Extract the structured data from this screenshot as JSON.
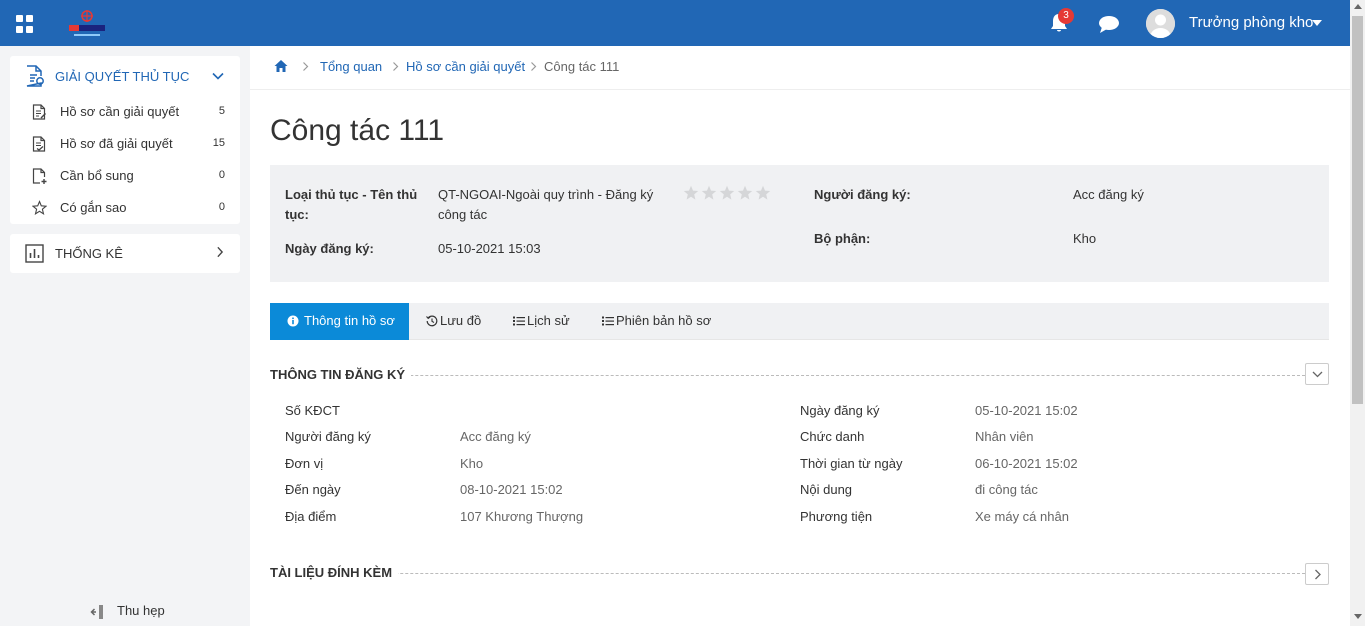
{
  "header": {
    "notification_count": "3",
    "username": "Trưởng phòng kho"
  },
  "sidebar": {
    "group_title": "GIẢI QUYẾT THỦ TỤC",
    "items": [
      {
        "label": "Hồ sơ cần giải quyết",
        "count": "5"
      },
      {
        "label": "Hồ sơ đã giải quyết",
        "count": "15"
      },
      {
        "label": "Cần bổ sung",
        "count": "0"
      },
      {
        "label": "Có gắn sao",
        "count": "0"
      }
    ],
    "stats_title": "THỐNG KÊ",
    "collapse_label": "Thu hẹp"
  },
  "breadcrumb": {
    "items": [
      "Tổng quan",
      "Hồ sơ cần giải quyết"
    ],
    "current": "Công tác 111"
  },
  "page": {
    "title": "Công tác 111"
  },
  "summary": {
    "type_label": "Loại thủ tục - Tên thủ tục:",
    "type_value": "QT-NGOAI-Ngoài quy trình - Đăng ký công tác",
    "date_label": "Ngày đăng ký:",
    "date_value": "05-10-2021 15:03",
    "registrant_label": "Người đăng ký:",
    "registrant_value": "Acc đăng ký",
    "dept_label": "Bộ phận:",
    "dept_value": "Kho",
    "stars_filled": 0,
    "stars_total": 5
  },
  "tabs": [
    {
      "label": "Thông tin hồ sơ",
      "active": true
    },
    {
      "label": "Lưu đồ",
      "active": false
    },
    {
      "label": "Lịch sử",
      "active": false
    },
    {
      "label": "Phiên bản hồ sơ",
      "active": false
    }
  ],
  "registration": {
    "title": "THÔNG TIN ĐĂNG KÝ",
    "left": [
      {
        "label": "Số KĐCT",
        "value": ""
      },
      {
        "label": "Người đăng ký",
        "value": "Acc đăng ký"
      },
      {
        "label": "Đơn vị",
        "value": "Kho"
      },
      {
        "label": "Đến ngày",
        "value": "08-10-2021 15:02"
      },
      {
        "label": "Địa điểm",
        "value": "107 Khương Thượng"
      }
    ],
    "right": [
      {
        "label": "Ngày đăng ký",
        "value": "05-10-2021 15:02"
      },
      {
        "label": "Chức danh",
        "value": "Nhân viên"
      },
      {
        "label": "Thời gian từ ngày",
        "value": "06-10-2021 15:02"
      },
      {
        "label": "Nội dung",
        "value": "đi công tác"
      },
      {
        "label": "Phương tiện",
        "value": "Xe máy cá nhân"
      }
    ]
  },
  "attachments": {
    "title": "TÀI LIỆU ĐÍNH KÈM"
  },
  "colors": {
    "header_bg": "#2167b5",
    "tab_active": "#0b8ad8",
    "link": "#2167b5",
    "badge": "#e53935"
  }
}
